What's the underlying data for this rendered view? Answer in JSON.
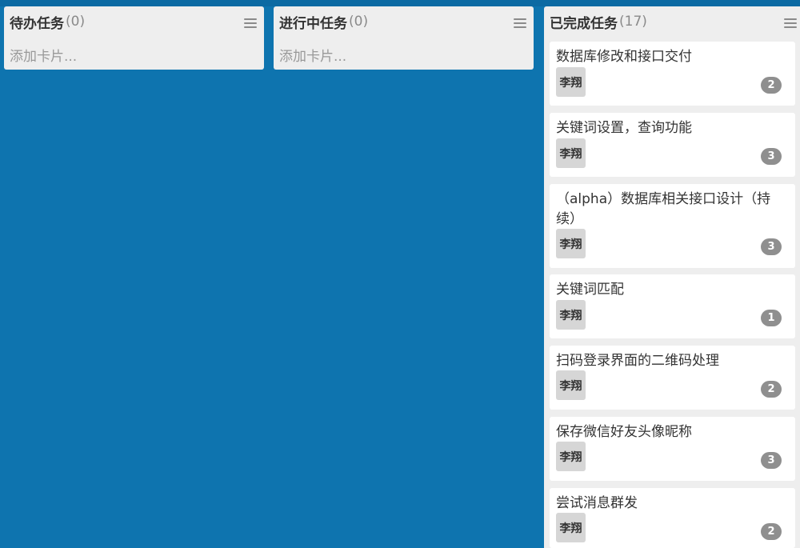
{
  "lists": [
    {
      "title": "待办任务",
      "count": "(0)",
      "add_label": "添加卡片..."
    },
    {
      "title": "进行中任务",
      "count": "(0)",
      "add_label": "添加卡片..."
    },
    {
      "title": "已完成任务",
      "count": "(17)",
      "cards": [
        {
          "title": "数据库修改和接口交付",
          "member": "李翔",
          "badge": "2"
        },
        {
          "title": "关键词设置，查询功能",
          "member": "李翔",
          "badge": "3"
        },
        {
          "title": "（alpha）数据库相关接口设计（持续）",
          "member": "李翔",
          "badge": "3"
        },
        {
          "title": "关键词匹配",
          "member": "李翔",
          "badge": "1"
        },
        {
          "title": "扫码登录界面的二维码处理",
          "member": "李翔",
          "badge": "2"
        },
        {
          "title": "保存微信好友头像昵称",
          "member": "李翔",
          "badge": "3"
        },
        {
          "title": "尝试消息群发",
          "member": "李翔",
          "badge": "2"
        }
      ]
    }
  ],
  "colors": {
    "board_background": "#0e74af",
    "list_background": "#eeeeee",
    "badge": "#8f8f8f"
  }
}
